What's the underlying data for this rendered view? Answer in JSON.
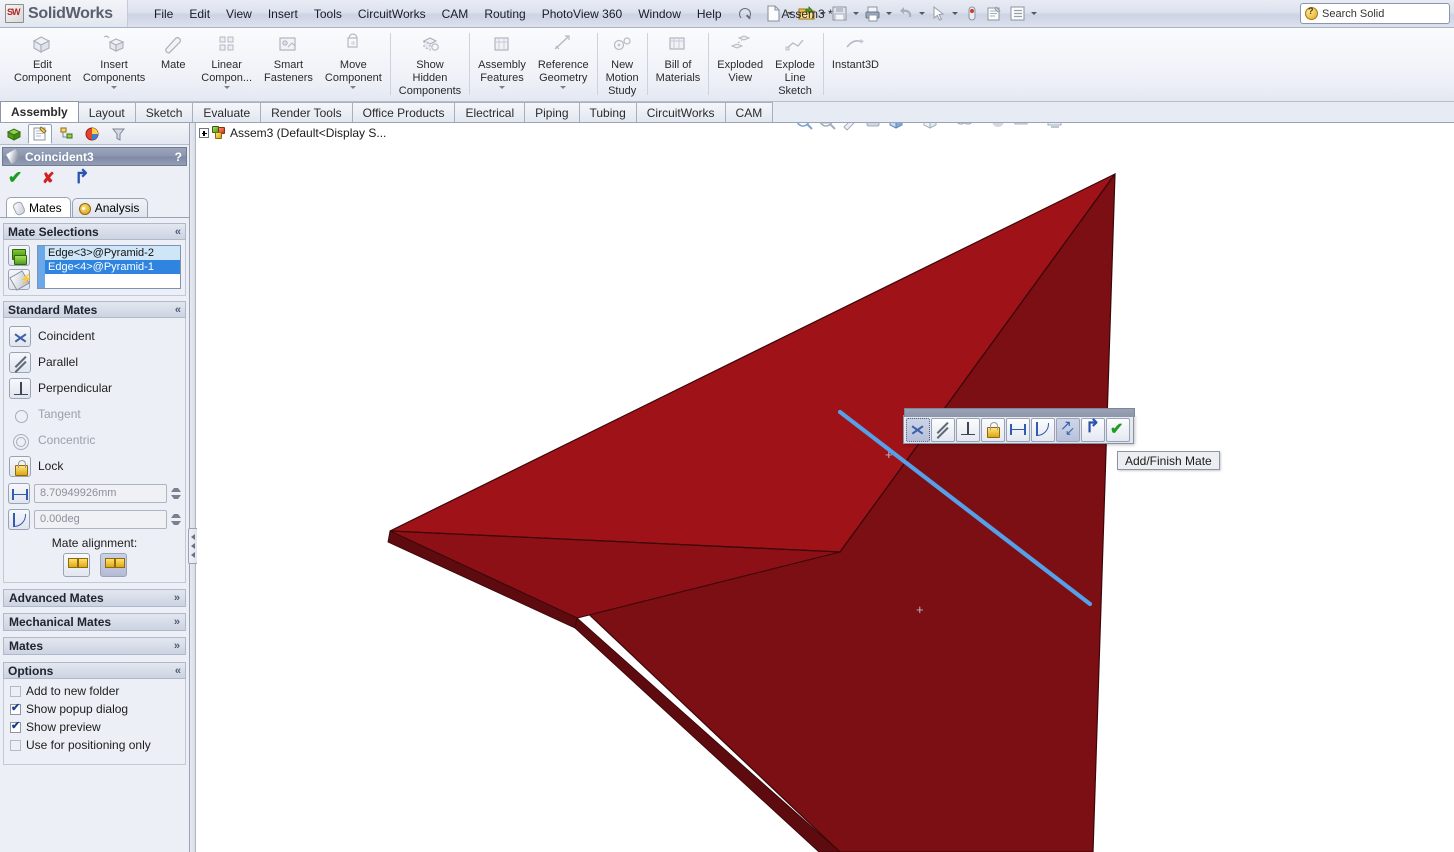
{
  "app": {
    "brand": "SolidWorks",
    "document_title": "Assem3 *",
    "search_placeholder": "Search Solid"
  },
  "menu": {
    "items": [
      "File",
      "Edit",
      "View",
      "Insert",
      "Tools",
      "CircuitWorks",
      "CAM",
      "Routing",
      "PhotoView 360",
      "Window",
      "Help"
    ],
    "pin_icon": "pin-icon"
  },
  "quick_tools": [
    {
      "name": "new-document-icon",
      "caret": true
    },
    {
      "name": "open-folder-icon",
      "caret": true
    },
    {
      "name": "save-icon",
      "caret": true
    },
    {
      "name": "print-icon",
      "caret": true
    },
    {
      "name": "undo-icon",
      "caret": true
    },
    {
      "name": "select-cursor-icon",
      "caret": true
    },
    {
      "name": "rebuild-icon",
      "caret": false
    },
    {
      "name": "options-icon",
      "caret": false
    },
    {
      "name": "customize-list-icon",
      "caret": true
    }
  ],
  "ribbon": {
    "buttons": [
      {
        "label": "Edit\nComponent",
        "icon": "edit-component-icon",
        "caret": false
      },
      {
        "label": "Insert\nComponents",
        "icon": "insert-components-icon",
        "caret": true
      },
      {
        "label": "Mate",
        "icon": "mate-icon",
        "caret": false
      },
      {
        "label": "Linear\nCompon...",
        "icon": "linear-component-pattern-icon",
        "caret": true
      },
      {
        "label": "Smart\nFasteners",
        "icon": "smart-fasteners-icon",
        "caret": false
      },
      {
        "label": "Move\nComponent",
        "icon": "move-component-icon",
        "caret": true
      },
      {
        "label": "Show\nHidden\nComponents",
        "icon": "show-hidden-components-icon",
        "caret": false
      },
      {
        "label": "Assembly\nFeatures",
        "icon": "assembly-features-icon",
        "caret": true
      },
      {
        "label": "Reference\nGeometry",
        "icon": "reference-geometry-icon",
        "caret": true
      },
      {
        "label": "New\nMotion\nStudy",
        "icon": "new-motion-study-icon",
        "caret": false
      },
      {
        "label": "Bill of\nMaterials",
        "icon": "bill-of-materials-icon",
        "caret": false
      },
      {
        "label": "Exploded\nView",
        "icon": "exploded-view-icon",
        "caret": false
      },
      {
        "label": "Explode\nLine\nSketch",
        "icon": "explode-line-sketch-icon",
        "caret": false
      },
      {
        "label": "Instant3D",
        "icon": "instant3d-icon",
        "caret": false
      }
    ]
  },
  "command_tabs": {
    "active": "Assembly",
    "items": [
      "Assembly",
      "Layout",
      "Sketch",
      "Evaluate",
      "Render Tools",
      "Office Products",
      "Electrical",
      "Piping",
      "Tubing",
      "CircuitWorks",
      "CAM"
    ]
  },
  "tree_tabs": [
    {
      "name": "feature-manager-tab",
      "active": false
    },
    {
      "name": "property-manager-tab",
      "active": true
    },
    {
      "name": "configuration-manager-tab",
      "active": false
    },
    {
      "name": "display-manager-tab",
      "active": false
    },
    {
      "name": "dimxpert-manager-tab",
      "active": false
    }
  ],
  "property_manager": {
    "title": "Coincident3",
    "help_label": "?",
    "actions": [
      {
        "name": "ok-button",
        "glyph": "check"
      },
      {
        "name": "cancel-button",
        "glyph": "x"
      },
      {
        "name": "undo-button",
        "glyph": "undo"
      }
    ],
    "tabs": [
      {
        "label": "Mates",
        "active": true
      },
      {
        "label": "Analysis",
        "active": false
      }
    ],
    "mate_selections": {
      "header": "Mate Selections",
      "chevron": "«",
      "entities": [
        {
          "label": "Edge<3>@Pyramid-2",
          "selected": false
        },
        {
          "label": "Edge<4>@Pyramid-1",
          "selected": true
        }
      ]
    },
    "standard_mates": {
      "header": "Standard Mates",
      "chevron": "«",
      "items": [
        {
          "label": "Coincident",
          "icon": "coincident-icon",
          "enabled": true,
          "active": true
        },
        {
          "label": "Parallel",
          "icon": "parallel-icon",
          "enabled": true,
          "active": false
        },
        {
          "label": "Perpendicular",
          "icon": "perpendicular-icon",
          "enabled": true,
          "active": false
        },
        {
          "label": "Tangent",
          "icon": "tangent-icon",
          "enabled": false,
          "active": false
        },
        {
          "label": "Concentric",
          "icon": "concentric-icon",
          "enabled": false,
          "active": false
        },
        {
          "label": "Lock",
          "icon": "lock-icon",
          "enabled": true,
          "active": false
        }
      ],
      "distance_value": "8.70949926mm",
      "angle_value": "0.00deg",
      "alignment_label": "Mate alignment:",
      "alignment_buttons": [
        {
          "name": "aligned-button",
          "active": false
        },
        {
          "name": "anti-aligned-button",
          "active": true
        }
      ]
    },
    "collapsed_sections": [
      {
        "label": "Advanced Mates",
        "chevron": "»"
      },
      {
        "label": "Mechanical Mates",
        "chevron": "»"
      },
      {
        "label": "Mates",
        "chevron": "»"
      }
    ],
    "options": {
      "header": "Options",
      "chevron": "«",
      "items": [
        {
          "label": "Add to new folder",
          "checked": false
        },
        {
          "label": "Show popup dialog",
          "checked": true
        },
        {
          "label": "Show preview",
          "checked": true
        },
        {
          "label": "Use for positioning only",
          "checked": false
        }
      ]
    }
  },
  "feature_tree": {
    "root_label": "Assem3  (Default<Display S..."
  },
  "view_toolbar": [
    {
      "name": "zoom-to-fit-icon",
      "caret": false
    },
    {
      "name": "zoom-to-area-icon",
      "caret": false
    },
    {
      "name": "previous-view-icon",
      "caret": false
    },
    {
      "name": "section-view-icon",
      "caret": false
    },
    {
      "name": "view-orientation-icon",
      "caret": true
    },
    {
      "name": "display-style-icon",
      "caret": true
    },
    {
      "name": "hide-show-items-icon",
      "caret": true
    },
    {
      "name": "edit-appearance-icon",
      "caret": false
    },
    {
      "name": "apply-scene-icon",
      "caret": true
    },
    {
      "name": "view-settings-icon",
      "caret": true
    }
  ],
  "popup_toolbar": {
    "buttons": [
      {
        "name": "coincident-mate-button",
        "icon": "coincident-icon",
        "state": "selected"
      },
      {
        "name": "parallel-mate-button",
        "icon": "parallel-icon",
        "state": "normal"
      },
      {
        "name": "perpendicular-mate-button",
        "icon": "perpendicular-icon",
        "state": "normal"
      },
      {
        "name": "lock-mate-button",
        "icon": "lock-icon",
        "state": "normal"
      },
      {
        "name": "distance-mate-button",
        "icon": "distance-icon",
        "state": "normal"
      },
      {
        "name": "angle-mate-button",
        "icon": "angle-icon",
        "state": "normal"
      },
      {
        "name": "mate-alignment-button",
        "icon": "alignment-arrows-icon",
        "state": "active"
      },
      {
        "name": "undo-button",
        "icon": "undo-icon",
        "state": "normal"
      },
      {
        "name": "add-finish-mate-button",
        "icon": "check-icon",
        "state": "normal"
      }
    ],
    "tooltip": "Add/Finish Mate"
  },
  "model": {
    "face_colors": {
      "top_left_face": "#9e1218",
      "right_face": "#7c0f14",
      "lower_face": "#8f1016",
      "thin_edge": "#5e0b10",
      "outline": "#3a070a"
    },
    "highlight_edge_color": "#55a0e8"
  }
}
